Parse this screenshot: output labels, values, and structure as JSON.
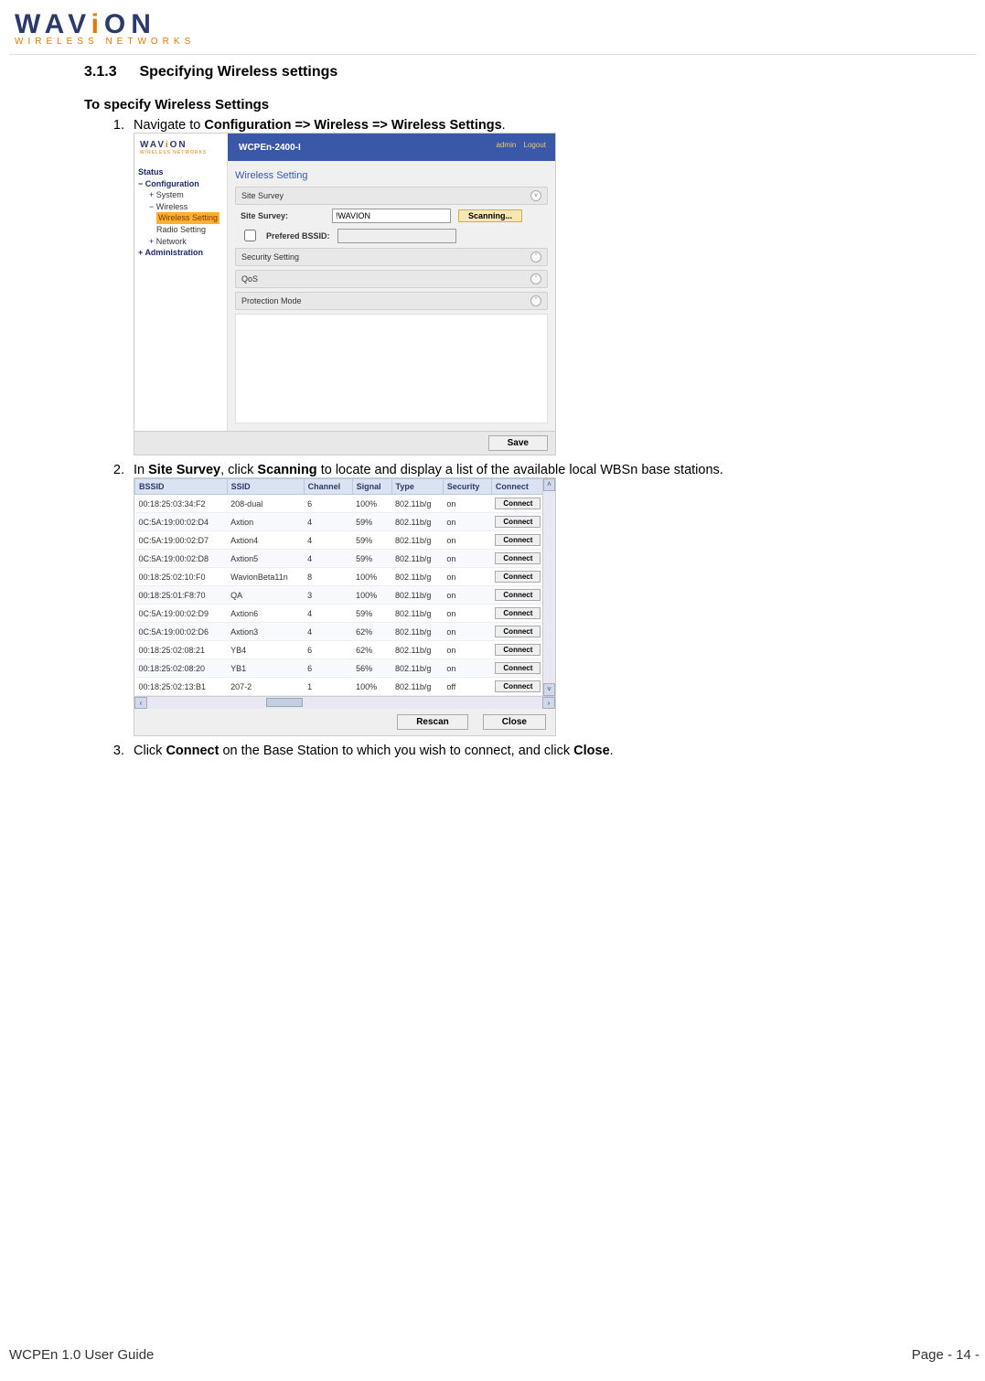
{
  "logo": {
    "word_pre": "WAV",
    "word_i": "i",
    "word_suf": "ON",
    "sub": "WIRELESS NETWORKS"
  },
  "section": {
    "num": "3.1.3",
    "title": "Specifying Wireless settings"
  },
  "subhead": "To specify Wireless Settings",
  "step1_pre": "Navigate to ",
  "step1_b1": "Configuration => Wireless => Wireless Settings",
  "step1_post": ".",
  "step2_pre": "In ",
  "step2_b1": "Site Survey",
  "step2_mid": ", click ",
  "step2_b2": "Scanning",
  "step2_post": " to locate and display a list of the available local WBSn base stations.",
  "step3_pre": "Click ",
  "step3_b1": "Connect",
  "step3_mid": " on the Base Station to which you wish to connect, and click ",
  "step3_b2": "Close",
  "step3_post": ".",
  "shot1": {
    "device": "WCPEn-2400-I",
    "admin": "admin",
    "logout": "Logout",
    "nav": {
      "status": "Status",
      "config": "Configuration",
      "system": "System",
      "wireless": "Wireless",
      "wset": "Wireless Setting",
      "rset": "Radio Setting",
      "network": "Network",
      "admin": "Administration"
    },
    "panel_title": "Wireless Setting",
    "sections": {
      "site_survey": "Site Survey",
      "security": "Security Setting",
      "qos": "QoS",
      "prot": "Protection Mode"
    },
    "labels": {
      "site_survey": "Site Survey:",
      "prefered": "Prefered BSSID:"
    },
    "ssid_value": "!WAVION",
    "btn_scan": "Scanning...",
    "btn_save": "Save"
  },
  "shot2": {
    "headers": [
      "BSSID",
      "SSID",
      "Channel",
      "Signal",
      "Type",
      "Security",
      "Connect"
    ],
    "rows": [
      [
        "00:18:25:03:34:F2",
        "208-dual",
        "6",
        "100%",
        "802.11b/g",
        "on"
      ],
      [
        "0C:5A:19:00:02:D4",
        "Axtion",
        "4",
        "59%",
        "802.11b/g",
        "on"
      ],
      [
        "0C:5A:19:00:02:D7",
        "Axtion4",
        "4",
        "59%",
        "802.11b/g",
        "on"
      ],
      [
        "0C:5A:19:00:02:D8",
        "Axtion5",
        "4",
        "59%",
        "802.11b/g",
        "on"
      ],
      [
        "00:18:25:02:10:F0",
        "WavionBeta11n",
        "8",
        "100%",
        "802.11b/g",
        "on"
      ],
      [
        "00:18:25:01:F8:70",
        "QA",
        "3",
        "100%",
        "802.11b/g",
        "on"
      ],
      [
        "0C:5A:19:00:02:D9",
        "Axtion6",
        "4",
        "59%",
        "802.11b/g",
        "on"
      ],
      [
        "0C:5A:19:00:02:D6",
        "Axtion3",
        "4",
        "62%",
        "802.11b/g",
        "on"
      ],
      [
        "00:18:25:02:08:21",
        "YB4",
        "6",
        "62%",
        "802.11b/g",
        "on"
      ],
      [
        "00:18:25:02:08:20",
        "YB1",
        "6",
        "56%",
        "802.11b/g",
        "on"
      ],
      [
        "00:18:25:02:13:B1",
        "207-2",
        "1",
        "100%",
        "802.11b/g",
        "off"
      ]
    ],
    "btn_connect": "Connect",
    "btn_rescan": "Rescan",
    "btn_close": "Close"
  },
  "footer": {
    "left": "WCPEn 1.0 User Guide",
    "right": "Page - 14 -"
  }
}
